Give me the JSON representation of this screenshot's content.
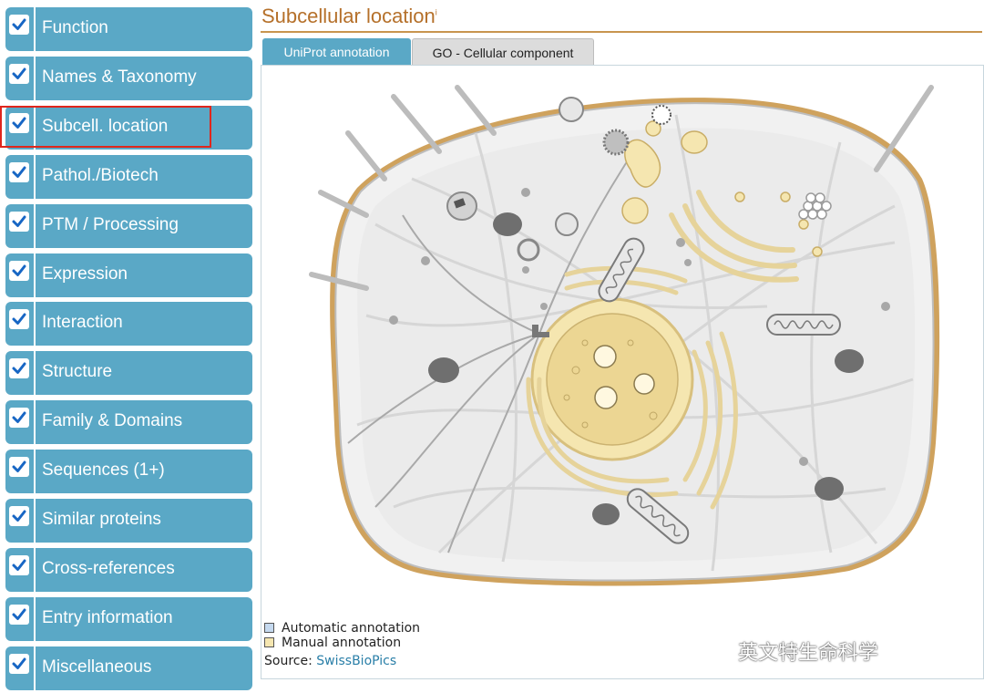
{
  "sidebar": {
    "items": [
      {
        "label": "Function",
        "checked": true
      },
      {
        "label": "Names & Taxonomy",
        "checked": true
      },
      {
        "label": "Subcell. location",
        "checked": true,
        "highlighted": true
      },
      {
        "label": "Pathol./Biotech",
        "checked": true
      },
      {
        "label": "PTM / Processing",
        "checked": true
      },
      {
        "label": "Expression",
        "checked": true
      },
      {
        "label": "Interaction",
        "checked": true
      },
      {
        "label": "Structure",
        "checked": true
      },
      {
        "label": "Family & Domains",
        "checked": true
      },
      {
        "label": "Sequences (1+)",
        "checked": true
      },
      {
        "label": "Similar proteins",
        "checked": true
      },
      {
        "label": "Cross-references",
        "checked": true
      },
      {
        "label": "Entry information",
        "checked": true
      },
      {
        "label": "Miscellaneous",
        "checked": true
      }
    ]
  },
  "section": {
    "title": "Subcellular location",
    "info_marker": "i",
    "tabs": [
      {
        "label": "UniProt annotation",
        "active": true
      },
      {
        "label": "GO - Cellular component",
        "active": false
      }
    ]
  },
  "legend": {
    "automatic": "Automatic annotation",
    "manual": "Manual annotation"
  },
  "source": {
    "label": "Source:",
    "link": "SwissBioPics"
  },
  "watermark": {
    "text": "英文特生命科学"
  },
  "colors": {
    "sidebar_item": "#5aa8c6",
    "highlight_border": "#e0261c",
    "title": "#b5702a",
    "manual_annotation": "#f5e6b0",
    "automatic_annotation": "#c5d9ef"
  }
}
